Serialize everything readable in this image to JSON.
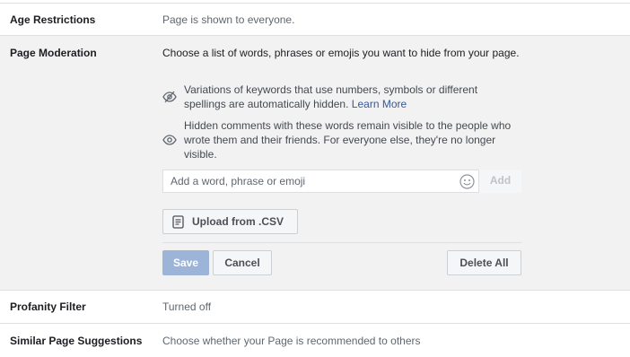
{
  "rows": {
    "age_restrictions": {
      "label": "Age Restrictions",
      "value": "Page is shown to everyone."
    },
    "page_moderation": {
      "label": "Page Moderation",
      "description": "Choose a list of words, phrases or emojis you want to hide from your page.",
      "info_variations": {
        "text": "Variations of keywords that use numbers, symbols or different spellings are automatically hidden.",
        "link": "Learn More",
        "icon": "eye-slash-icon"
      },
      "info_hidden": {
        "text": "Hidden comments with these words remain visible to the people who wrote them and their friends. For everyone else, they're no longer visible.",
        "icon": "eye-icon"
      },
      "input": {
        "placeholder": "Add a word, phrase or emoji",
        "value": ""
      },
      "add_label": "Add",
      "upload_label": "Upload from .CSV",
      "save_label": "Save",
      "cancel_label": "Cancel",
      "delete_all_label": "Delete All"
    },
    "profanity_filter": {
      "label": "Profanity Filter",
      "value": "Turned off"
    },
    "similar_page_suggestions": {
      "label": "Similar Page Suggestions",
      "value": "Choose whether your Page is recommended to others"
    }
  },
  "colors": {
    "link": "#385898",
    "save_disabled": "#9cb4d8",
    "moderation_bg": "#f2f2f2"
  }
}
